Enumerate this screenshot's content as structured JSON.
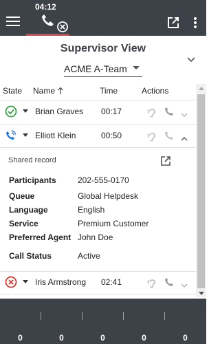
{
  "topbar": {
    "timer": "04:12",
    "menu_icon": "hamburger-menu-icon",
    "call_icon": "phone-disconnect-icon",
    "popout_icon": "open-in-new-icon",
    "more_icon": "more-vertical-icon",
    "call_underline_color": "#d6434b"
  },
  "header": {
    "title": "Supervisor View",
    "team_selected": "ACME A-Team",
    "collapse_icon": "chevron-down-icon"
  },
  "table": {
    "columns": {
      "state": "State",
      "name": "Name",
      "time": "Time",
      "actions": "Actions"
    },
    "rows": [
      {
        "name": "Brian Graves",
        "time": "00:17",
        "state_icon": "check-circle-icon",
        "state_color": "#2e9e3e",
        "expanded": false
      },
      {
        "name": "Elliott Klein",
        "time": "00:50",
        "state_icon": "phone-call-icon",
        "state_color": "#1a73e8",
        "expanded": true
      },
      {
        "name": "Iris Armstrong",
        "time": "02:41",
        "state_icon": "cancel-circle-icon",
        "state_color": "#d93025",
        "expanded": false
      }
    ]
  },
  "details": {
    "shared_label": "Shared record",
    "fields": [
      {
        "label": "Participants",
        "value": "202-555-0170"
      },
      {
        "label": "Queue",
        "value": "Global Helpdesk"
      },
      {
        "label": "Language",
        "value": "English"
      },
      {
        "label": "Service",
        "value": "Premium Customer"
      },
      {
        "label": "Preferred Agent",
        "value": "John Doe"
      },
      {
        "label": "Call Status",
        "value": "Active"
      }
    ]
  },
  "footer": {
    "counts": [
      "0",
      "0",
      "0",
      "0",
      "0"
    ]
  }
}
